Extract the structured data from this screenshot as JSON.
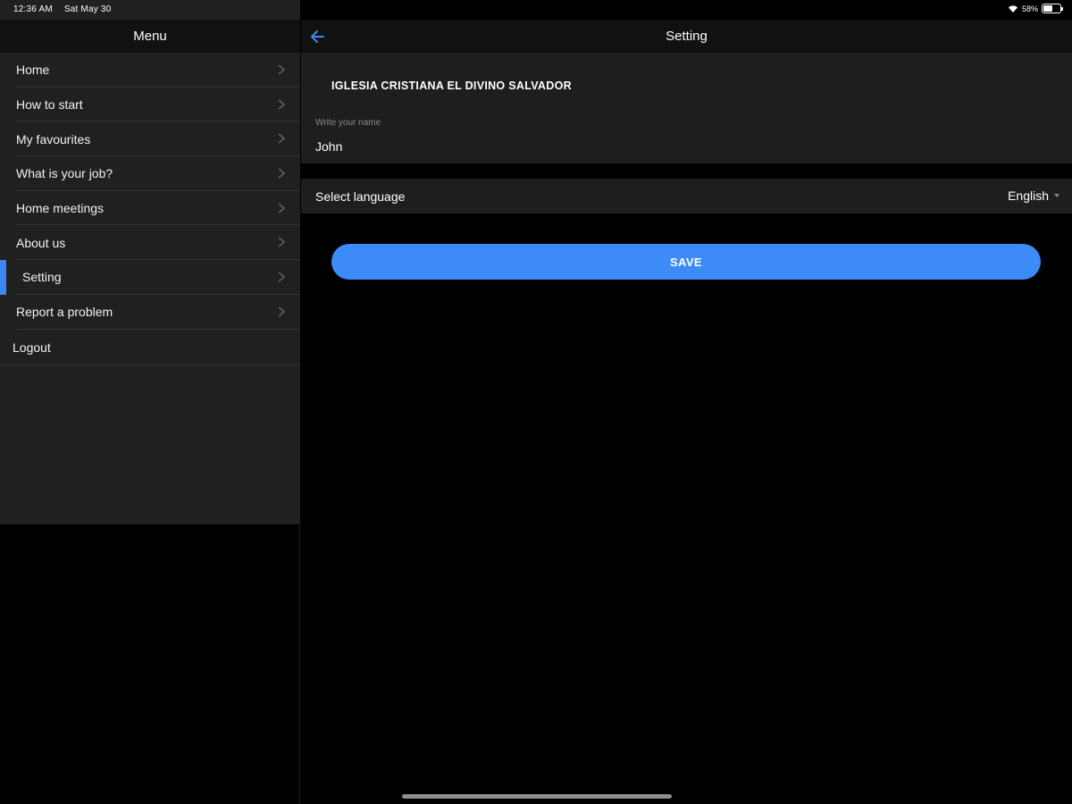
{
  "status_bar": {
    "time": "12:36 AM",
    "date": "Sat May 30",
    "battery": "58%",
    "battery_level": 0.58
  },
  "sidebar": {
    "title": "Menu",
    "items": [
      {
        "label": "Home"
      },
      {
        "label": "How to start"
      },
      {
        "label": "My favourites"
      },
      {
        "label": "What is your job?"
      },
      {
        "label": "Home meetings"
      },
      {
        "label": "About us"
      },
      {
        "label": "Setting"
      },
      {
        "label": "Report a problem"
      }
    ],
    "logout_label": "Logout"
  },
  "header": {
    "title": "Setting"
  },
  "settings": {
    "organization": "IGLESIA CRISTIANA EL DIVINO SALVADOR",
    "name_label": "Write your name",
    "name_value": "John",
    "language_label": "Select language",
    "language_value": "English"
  },
  "save_label": "SAVE",
  "colors": {
    "accent": "#3d8bf6",
    "sidebar_bg": "#202020",
    "card_bg": "#1e1e1e",
    "background": "#000000"
  }
}
